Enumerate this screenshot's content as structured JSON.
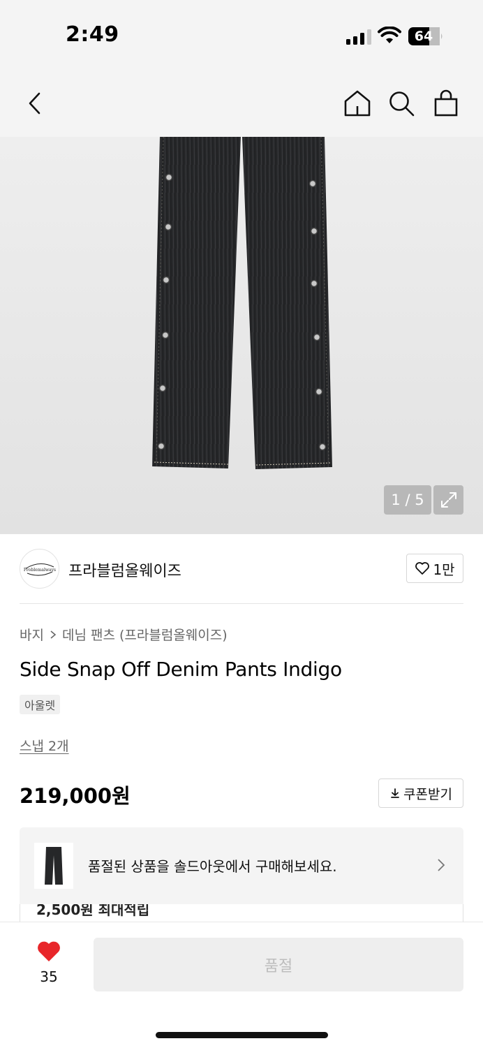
{
  "status_bar": {
    "time": "2:49",
    "battery": "64"
  },
  "nav": {
    "back_icon": "chevron-left-icon",
    "home_icon": "home-icon",
    "search_icon": "search-icon",
    "cart_icon": "shopping-bag-icon"
  },
  "gallery": {
    "counter": "1 / 5"
  },
  "brand": {
    "logo_text": "Problemalways",
    "name": "프라블럼올웨이즈",
    "like_count": "1만"
  },
  "breadcrumb": {
    "category": "바지",
    "subcategory": "데님 팬츠 (프라블럼올웨이즈)"
  },
  "product": {
    "title": "Side Snap Off Denim Pants Indigo",
    "tag": "아울렛",
    "snaps_link": "스냅 2개",
    "price": "219,000원",
    "coupon_label": "쿠폰받기"
  },
  "promo": {
    "text": "품절된 상품을 솔드아웃에서 구매해보세요.",
    "points": "2,500원 최대적립"
  },
  "bottom": {
    "like_count": "35",
    "soldout_label": "품절",
    "heart_color": "#e8262a"
  }
}
